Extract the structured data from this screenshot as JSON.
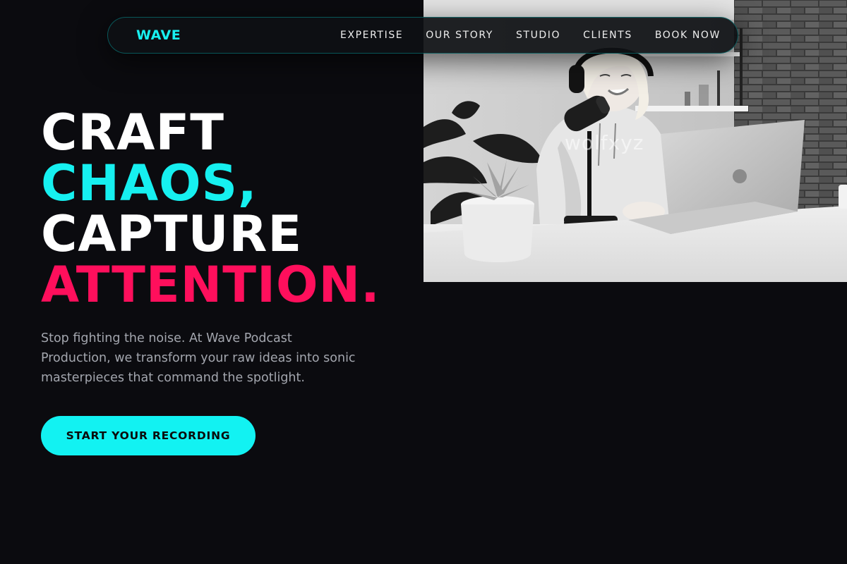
{
  "brand": {
    "logo": "WAVE",
    "accent_color": "#16f0f0",
    "highlight_color": "#ff0f5c",
    "background_color": "#0b0b0f"
  },
  "nav": {
    "items": [
      {
        "label": "EXPERTISE"
      },
      {
        "label": "OUR STORY"
      },
      {
        "label": "STUDIO"
      },
      {
        "label": "CLIENTS"
      },
      {
        "label": "BOOK NOW"
      }
    ]
  },
  "hero": {
    "headline": {
      "line1": "CRAFT",
      "line2": "CHAOS,",
      "line3": "CAPTURE",
      "line4": "ATTENTION."
    },
    "subtext": "Stop fighting the noise. At Wave Podcast Production, we transform your raw ideas into sonic masterpieces that command the spotlight.",
    "cta_label": "START YOUR RECORDING",
    "photo": {
      "description_icon": "podcast-host-photo",
      "watermark": "wolfxyz"
    }
  }
}
